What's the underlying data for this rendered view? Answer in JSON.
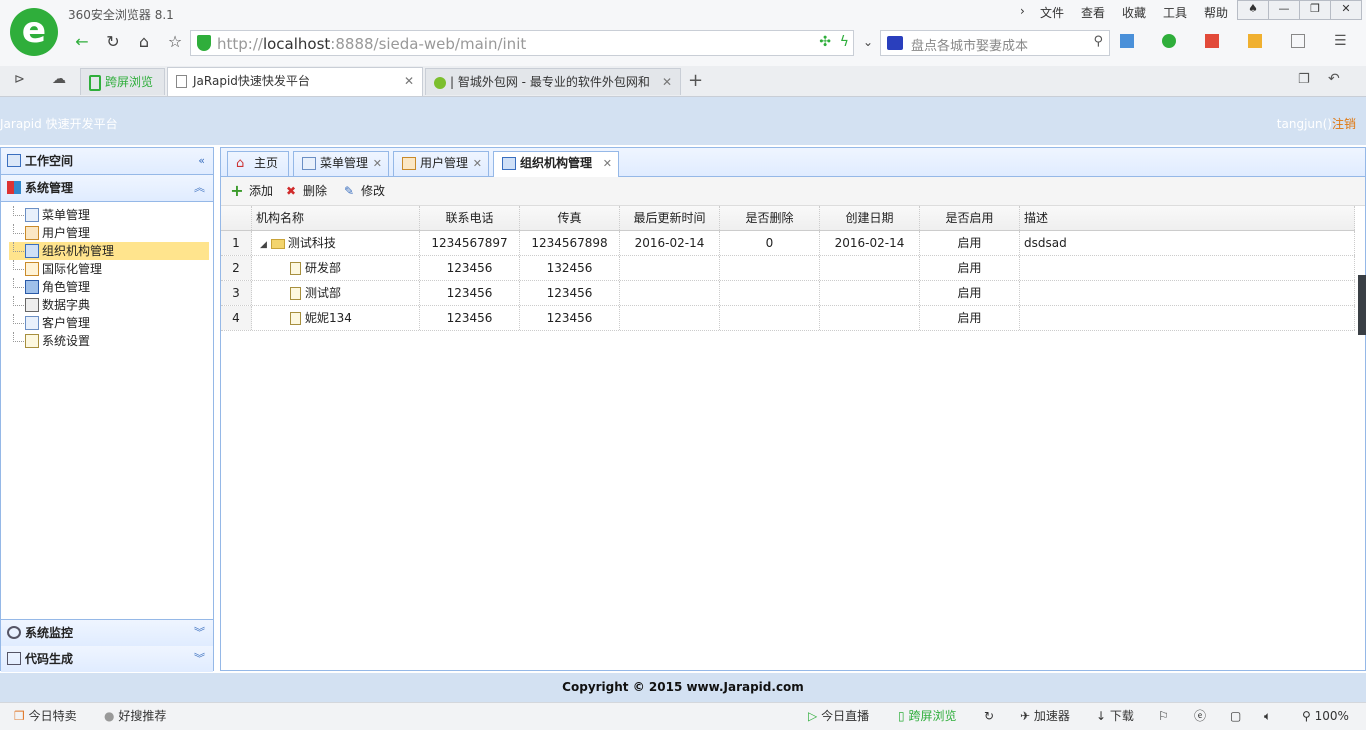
{
  "browser": {
    "name": "360安全浏览器 8.1",
    "menus": [
      "文件",
      "查看",
      "收藏",
      "工具",
      "帮助"
    ],
    "url_host_prefix": "http://",
    "url_host": "localhost",
    "url_rest": ":8888/sieda-web/main/init",
    "search_placeholder": "盘点各城市娶妻成本",
    "tabs": [
      {
        "label": "跨屏浏览"
      },
      {
        "label": "JaRapid快速快发平台"
      },
      {
        "label": "| 智城外包网 - 最专业的软件外包网和"
      }
    ],
    "status": {
      "left1": "今日特卖",
      "left2": "好搜推荐",
      "right1": "今日直播",
      "right2": "跨屏浏览",
      "right3": "加速器",
      "right4": "下载",
      "zoom": "100%"
    }
  },
  "app": {
    "title": "Jarapid 快速开发平台",
    "user": "tangjun()",
    "logout": "注销",
    "footer": "Copyright © 2015 www.Jarapid.com"
  },
  "sidebar": {
    "sections": [
      {
        "label": "工作空间"
      },
      {
        "label": "系统管理"
      },
      {
        "label": "系统监控"
      },
      {
        "label": "代码生成"
      }
    ],
    "items": [
      {
        "label": "菜单管理"
      },
      {
        "label": "用户管理"
      },
      {
        "label": "组织机构管理"
      },
      {
        "label": "国际化管理"
      },
      {
        "label": "角色管理"
      },
      {
        "label": "数据字典"
      },
      {
        "label": "客户管理"
      },
      {
        "label": "系统设置"
      }
    ]
  },
  "panel_tabs": [
    {
      "label": "主页"
    },
    {
      "label": "菜单管理"
    },
    {
      "label": "用户管理"
    },
    {
      "label": "组织机构管理"
    }
  ],
  "toolbar": {
    "add": "添加",
    "delete": "删除",
    "edit": "修改"
  },
  "grid": {
    "columns": [
      "机构名称",
      "联系电话",
      "传真",
      "最后更新时间",
      "是否删除",
      "创建日期",
      "是否启用",
      "描述"
    ],
    "rows": [
      {
        "num": "1",
        "name": "测试科技",
        "phone": "1234567897",
        "fax": "1234567898",
        "updated": "2016-02-14",
        "deleted": "0",
        "created": "2016-02-14",
        "enabled": "启用",
        "desc": "dsdsad"
      },
      {
        "num": "2",
        "name": "研发部",
        "phone": "123456",
        "fax": "132456",
        "updated": "",
        "deleted": "",
        "created": "",
        "enabled": "启用",
        "desc": ""
      },
      {
        "num": "3",
        "name": "测试部",
        "phone": "123456",
        "fax": "123456",
        "updated": "",
        "deleted": "",
        "created": "",
        "enabled": "启用",
        "desc": ""
      },
      {
        "num": "4",
        "name": "妮妮134",
        "phone": "123456",
        "fax": "123456",
        "updated": "",
        "deleted": "",
        "created": "",
        "enabled": "启用",
        "desc": ""
      }
    ]
  }
}
